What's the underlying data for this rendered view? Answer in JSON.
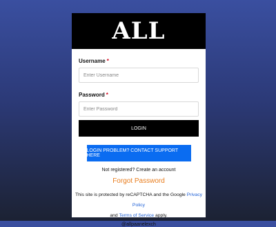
{
  "brand": {
    "logo_text": "ALL"
  },
  "form": {
    "username_label": "Username",
    "password_label": "Password",
    "required_mark": "*",
    "username_placeholder": "Enter Username",
    "password_placeholder": "Enter Password",
    "username_value": "",
    "password_value": "",
    "login_label": "LOGIN"
  },
  "support": {
    "label": "LOGIN PROBLEM? CONTACT SUPPORT HERE"
  },
  "links": {
    "register_text": "Not registered? Create an account",
    "forgot_password": "Forgot Password"
  },
  "captcha": {
    "prefix": "This site is protected by reCAPTCHA and the Google",
    "privacy": "Privacy Policy",
    "and": "and",
    "terms": "Terms of Service",
    "suffix": "apply."
  },
  "footer": {
    "handle": "@allpaanelexch"
  },
  "colors": {
    "accent_blue": "#0a6cf1",
    "forgot_orange": "#e87d1e",
    "link_blue": "#1d5fd6",
    "required_red": "#d0021b"
  }
}
